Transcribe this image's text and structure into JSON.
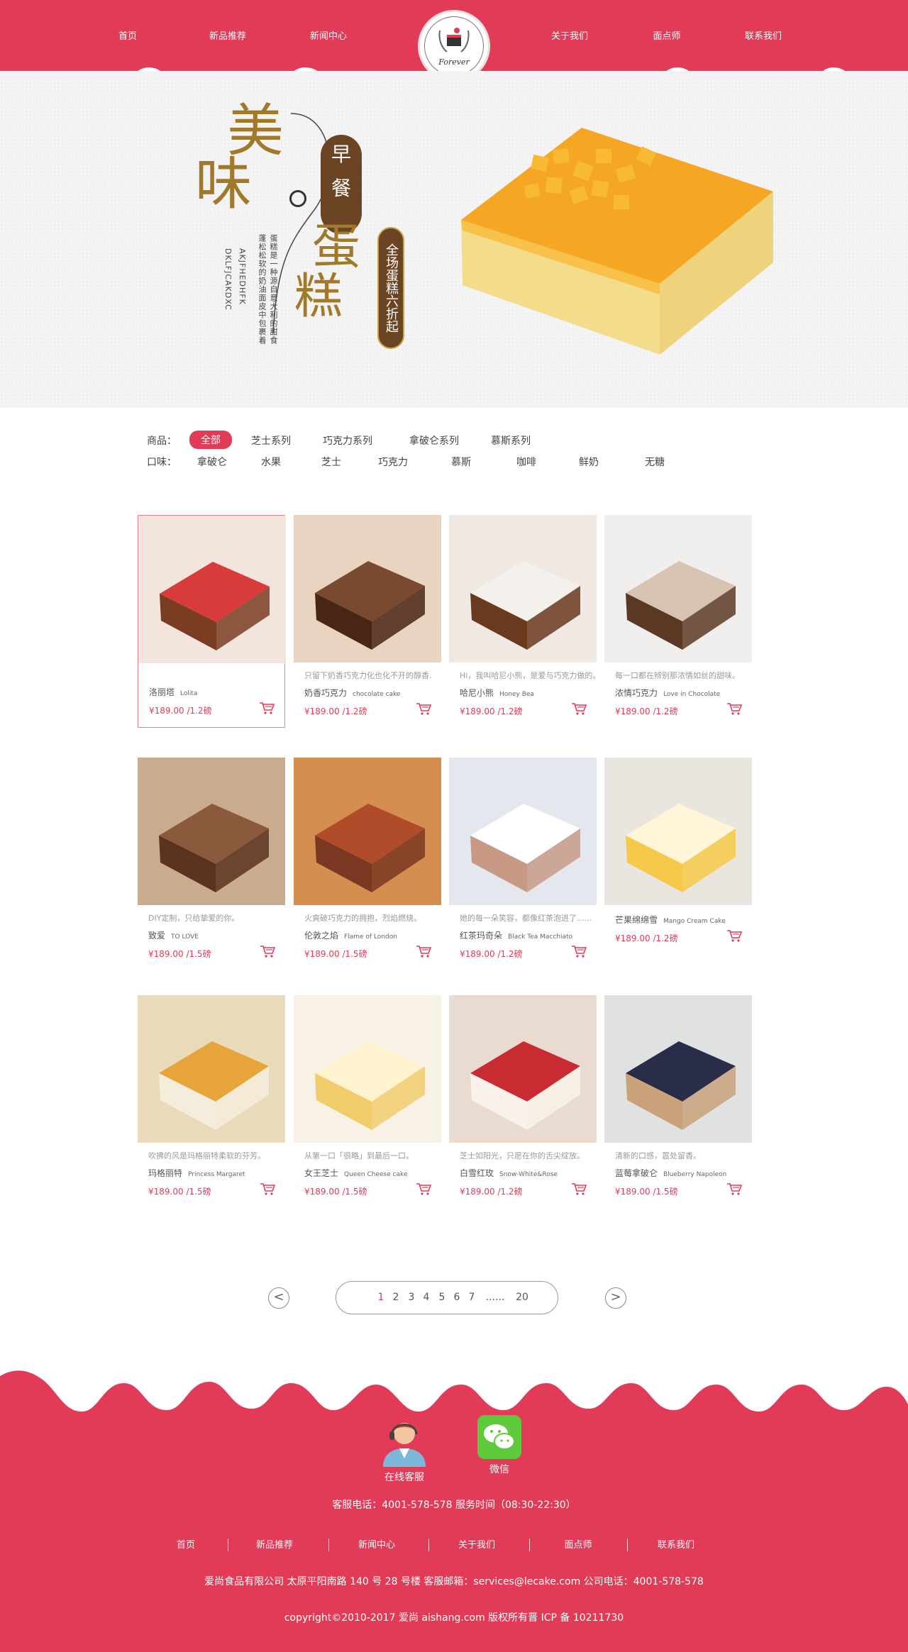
{
  "nav": {
    "left": [
      "首页",
      "新品推荐",
      "新闻中心"
    ],
    "right": [
      "关于我们",
      "面点师",
      "联系我们"
    ],
    "logo_text": "Forever"
  },
  "banner": {
    "t1": "美",
    "t2": "味",
    "zao1": "早",
    "zao2": "餐",
    "t3": "蛋",
    "t4": "糕",
    "sale": "全场蛋糕六折起",
    "vline1": "蛋糕是一种源自意大利的甜食",
    "vline2": "蓬松松软的奶油面皮中包裹着",
    "vline3": "AKJFHEDHFK",
    "vline4": "DKLFJCAKDXC"
  },
  "filters": {
    "goods_label": "商品：",
    "goods": [
      "全部",
      "芝士系列",
      "巧克力系列",
      "拿破仑系列",
      "慕斯系列"
    ],
    "taste_label": "口味：",
    "tastes": [
      "拿破仑",
      "水果",
      "芝士",
      "巧克力",
      "慕斯",
      "咖啡",
      "鲜奶",
      "无糖"
    ]
  },
  "products": [
    {
      "desc": "",
      "name": "洛丽塔",
      "en": "Lolita",
      "price": "¥189.00 /1.2磅"
    },
    {
      "desc": "只留下奶香巧克力化也化不开的醇香.",
      "name": "奶香巧克力",
      "en": "chocolate cake",
      "price": "¥189.00 /1.2磅"
    },
    {
      "desc": "Hi，我叫哈尼小熊，是爱与巧克力做的。",
      "name": "哈尼小熊",
      "en": "Honey Bea",
      "price": "¥189.00 /1.2磅"
    },
    {
      "desc": "每一口都在辨别那浓情如丝的甜味。",
      "name": "浓情巧克力",
      "en": "Love in Chocolate",
      "price": "¥189.00 /1.2磅"
    },
    {
      "desc": "DIY定制，只给挚爱的你。",
      "name": "致爱",
      "en": "TO LOVE",
      "price": "¥189.00 /1.5磅"
    },
    {
      "desc": "火爽破巧克力的拥抱，烈焰燃烧。",
      "name": "伦敦之焰",
      "en": "Flame of London",
      "price": "¥189.00 /1.5磅"
    },
    {
      "desc": "她的每一朵笑容，都像红茶泡进了......",
      "name": "红茶玛奇朵",
      "en": "Black Tea Macchiato",
      "price": "¥189.00 /1.2磅"
    },
    {
      "desc": "",
      "name": "芒果绵绵雪",
      "en": "Mango Cream Cake",
      "price": "¥189.00 /1.2磅"
    },
    {
      "desc": "吹拂的风是玛格丽特柔软的芬芳。",
      "name": "玛格丽特",
      "en": "Princess Margaret",
      "price": "¥189.00 /1.5磅"
    },
    {
      "desc": "从第一口「很略」到最后一口。",
      "name": "女王芝士",
      "en": "Queen Cheese cake",
      "price": "¥189.00 /1.5磅"
    },
    {
      "desc": "芝士如阳光，只愿在你的舌尖绽放。",
      "name": "白雪红玫",
      "en": "Snow-White&Rose",
      "price": "¥189.00 /1.2磅"
    },
    {
      "desc": "清新的口感，嚣处留香。",
      "name": "蓝莓拿破仑",
      "en": "Blueberry Napoleon",
      "price": "¥189.00 /1.5磅"
    }
  ],
  "pagination": {
    "prev": "<",
    "next": ">",
    "pages": [
      "1",
      "2",
      "3",
      "4",
      "5",
      "6",
      "7",
      "......",
      "20"
    ],
    "current": "1"
  },
  "footer": {
    "service_label": "在线客服",
    "wechat_label": "微信",
    "phone_line": "客服电话：4001-578-578 服务时间（08:30-22:30）",
    "nav": [
      "首页",
      "新品推荐",
      "新闻中心",
      "关于我们",
      "面点师",
      "联系我们"
    ],
    "company_line": "爱尚食品有限公司   太原平阳南路 140 号 28 号楼    客服邮箱：services@lecake.com  公司电话：4001-578-578",
    "copyright": "copyright©2010-2017 爱尚 aishang.com 版权所有晋 ICP 备 10211730"
  },
  "colors": {
    "brand": "#e23b57",
    "banner_brown": "#6b4424",
    "banner_gold": "#a07a2a"
  }
}
